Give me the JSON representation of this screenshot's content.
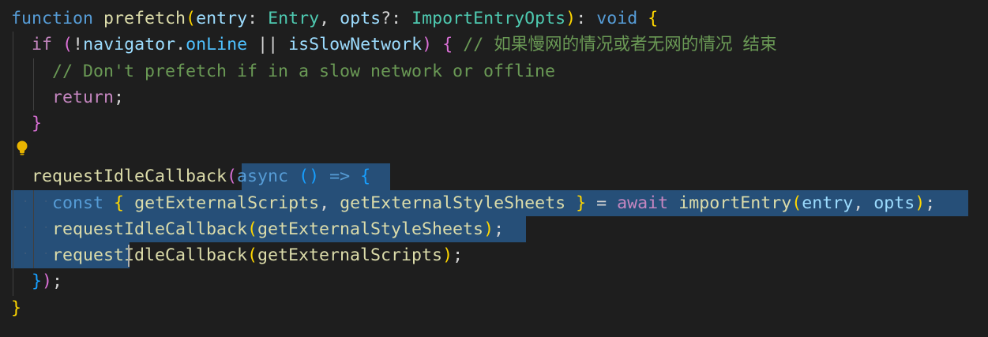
{
  "editor": {
    "colors": {
      "background": "#1e1e1e",
      "selection": "#264f78",
      "keyword": "#569cd6",
      "function": "#dcdcaa",
      "parameter": "#9cdcfe",
      "type": "#4ec9b0",
      "comment": "#6a9955"
    },
    "lines": [
      {
        "tokens": [
          {
            "t": "function",
            "c": "kw"
          },
          {
            "t": " ",
            "c": "pn"
          },
          {
            "t": "prefetch",
            "c": "fn"
          },
          {
            "t": "(",
            "c": "br1"
          },
          {
            "t": "entry",
            "c": "pm"
          },
          {
            "t": ": ",
            "c": "pn"
          },
          {
            "t": "Entry",
            "c": "ty"
          },
          {
            "t": ", ",
            "c": "pn"
          },
          {
            "t": "opts",
            "c": "pm"
          },
          {
            "t": "?: ",
            "c": "pn"
          },
          {
            "t": "ImportEntryOpts",
            "c": "ty"
          },
          {
            "t": ")",
            "c": "br1"
          },
          {
            "t": ": ",
            "c": "pn"
          },
          {
            "t": "void",
            "c": "kw"
          },
          {
            "t": " ",
            "c": "pn"
          },
          {
            "t": "{",
            "c": "br1"
          }
        ]
      },
      {
        "tokens": [
          {
            "t": "  ",
            "c": "pn"
          },
          {
            "t": "if",
            "c": "ctl"
          },
          {
            "t": " ",
            "c": "pn"
          },
          {
            "t": "(",
            "c": "br2"
          },
          {
            "t": "!",
            "c": "pn"
          },
          {
            "t": "navigator",
            "c": "pm"
          },
          {
            "t": ".",
            "c": "pn"
          },
          {
            "t": "onLine",
            "c": "pr"
          },
          {
            "t": " || ",
            "c": "pn"
          },
          {
            "t": "isSlowNetwork",
            "c": "pm"
          },
          {
            "t": ")",
            "c": "br2"
          },
          {
            "t": " ",
            "c": "pn"
          },
          {
            "t": "{",
            "c": "br2"
          },
          {
            "t": " // 如果慢网的情况或者无网的情况 结束",
            "c": "cm"
          }
        ]
      },
      {
        "tokens": [
          {
            "t": "    ",
            "c": "pn"
          },
          {
            "t": "// Don't prefetch if in a slow network or offline",
            "c": "cm"
          }
        ]
      },
      {
        "tokens": [
          {
            "t": "    ",
            "c": "pn"
          },
          {
            "t": "return",
            "c": "ctl"
          },
          {
            "t": ";",
            "c": "pn"
          }
        ]
      },
      {
        "tokens": [
          {
            "t": "  ",
            "c": "pn"
          },
          {
            "t": "}",
            "c": "br2"
          }
        ]
      },
      {
        "tokens": []
      },
      {
        "tokens": [
          {
            "t": "  ",
            "c": "pn"
          },
          {
            "t": "requestIdleCallback",
            "c": "fn"
          },
          {
            "t": "(",
            "c": "br2"
          },
          {
            "t": "async",
            "c": "kw"
          },
          {
            "t": " ",
            "c": "pn"
          },
          {
            "t": "()",
            "c": "br3"
          },
          {
            "t": " ",
            "c": "pn"
          },
          {
            "t": "=>",
            "c": "kw"
          },
          {
            "t": " ",
            "c": "pn"
          },
          {
            "t": "{",
            "c": "br3"
          }
        ]
      },
      {
        "tokens": [
          {
            "t": "    ",
            "c": "pn"
          },
          {
            "t": "const",
            "c": "kw"
          },
          {
            "t": " ",
            "c": "pn"
          },
          {
            "t": "{",
            "c": "br1"
          },
          {
            "t": " ",
            "c": "pn"
          },
          {
            "t": "getExternalScripts",
            "c": "fn"
          },
          {
            "t": ", ",
            "c": "pn"
          },
          {
            "t": "getExternalStyleSheets",
            "c": "fn"
          },
          {
            "t": " ",
            "c": "pn"
          },
          {
            "t": "}",
            "c": "br1"
          },
          {
            "t": " = ",
            "c": "pn"
          },
          {
            "t": "await",
            "c": "ctl"
          },
          {
            "t": " ",
            "c": "pn"
          },
          {
            "t": "importEntry",
            "c": "fn"
          },
          {
            "t": "(",
            "c": "br1"
          },
          {
            "t": "entry",
            "c": "pm"
          },
          {
            "t": ", ",
            "c": "pn"
          },
          {
            "t": "opts",
            "c": "pm"
          },
          {
            "t": ")",
            "c": "br1"
          },
          {
            "t": ";",
            "c": "pn"
          }
        ]
      },
      {
        "tokens": [
          {
            "t": "    ",
            "c": "pn"
          },
          {
            "t": "requestIdleCallback",
            "c": "fn"
          },
          {
            "t": "(",
            "c": "br1"
          },
          {
            "t": "getExternalStyleSheets",
            "c": "fn"
          },
          {
            "t": ")",
            "c": "br1"
          },
          {
            "t": ";",
            "c": "pn"
          }
        ]
      },
      {
        "tokens": [
          {
            "t": "    ",
            "c": "pn"
          },
          {
            "t": "requestIdleCallback",
            "c": "fn"
          },
          {
            "t": "(",
            "c": "br1"
          },
          {
            "t": "getExternalScripts",
            "c": "fn"
          },
          {
            "t": ")",
            "c": "br1"
          },
          {
            "t": ";",
            "c": "pn"
          }
        ]
      },
      {
        "tokens": [
          {
            "t": "  ",
            "c": "pn"
          },
          {
            "t": "}",
            "c": "br3"
          },
          {
            "t": ")",
            "c": "br2"
          },
          {
            "t": ";",
            "c": "pn"
          }
        ]
      },
      {
        "tokens": [
          {
            "t": "}",
            "c": "br1"
          }
        ]
      }
    ],
    "lightbulb_icon": "lightbulb-icon",
    "whitespace_marker": "·"
  }
}
